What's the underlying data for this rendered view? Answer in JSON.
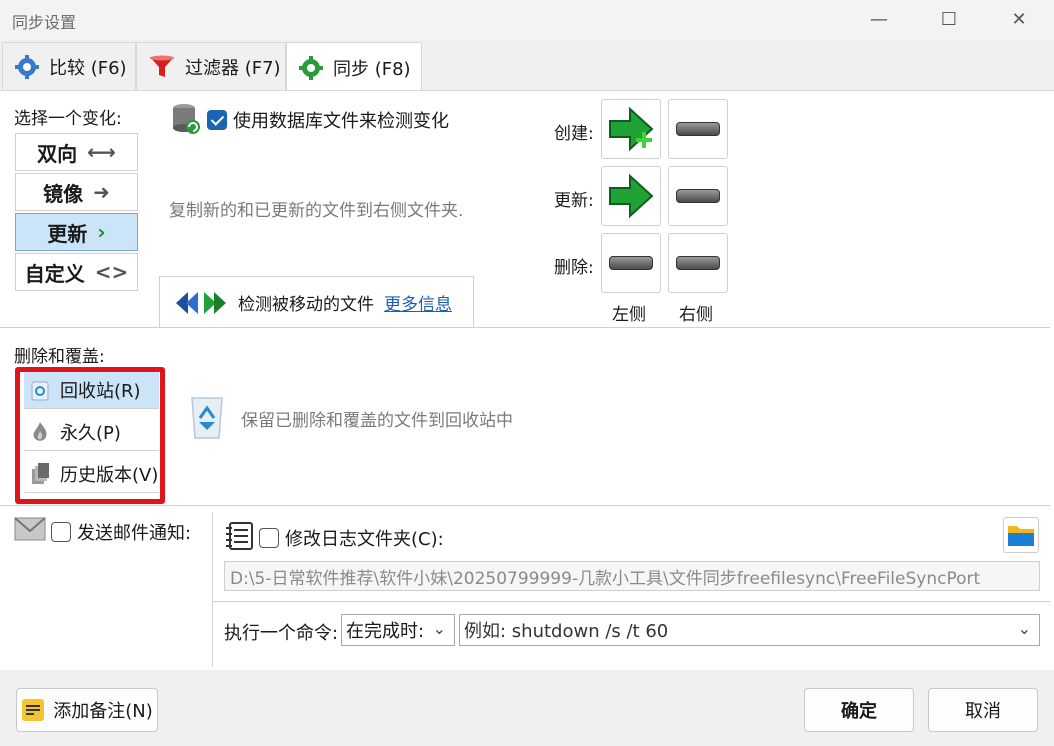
{
  "window": {
    "title": "同步设置",
    "minimize": "—",
    "maximize": "☐",
    "close": "✕"
  },
  "tabs": [
    {
      "label": "比较 (F6)",
      "icon": "gear-blue-icon"
    },
    {
      "label": "过滤器 (F7)",
      "icon": "funnel-red-icon"
    },
    {
      "label": "同步 (F8)",
      "icon": "gear-green-icon"
    }
  ],
  "variant": {
    "label": "选择一个变化:",
    "options": [
      {
        "label": "双向",
        "symbol": "⟷"
      },
      {
        "label": "镜像",
        "symbol": "➜"
      },
      {
        "label": "更新",
        "symbol": "›"
      },
      {
        "label": "自定义",
        "symbol": "<>"
      }
    ],
    "selected": "更新"
  },
  "database": {
    "label": "使用数据库文件来检测变化",
    "checked": true
  },
  "description": "复制新的和已更新的文件到右侧文件夹.",
  "detect": {
    "label": "检测被移动的文件",
    "more_info": "更多信息"
  },
  "actions": {
    "create_label": "创建:",
    "update_label": "更新:",
    "delete_label": "删除:",
    "left_label": "左侧",
    "right_label": "右侧"
  },
  "deletion": {
    "label": "删除和覆盖:",
    "options": [
      {
        "label": "回收站(R)"
      },
      {
        "label": "永久(P)"
      },
      {
        "label": "历史版本(V)"
      }
    ],
    "selected": "回收站(R)",
    "description": "保留已删除和覆盖的文件到回收站中"
  },
  "email": {
    "label": "发送邮件通知:",
    "checked": false
  },
  "log": {
    "label": "修改日志文件夹(C):",
    "checked": false,
    "path": "D:\\5-日常软件推荐\\软件小妹\\20250799999-几款小工具\\文件同步freefilesync\\FreeFileSyncPort"
  },
  "command": {
    "label": "执行一个命令:",
    "when": "在完成时:",
    "placeholder": "例如: shutdown /s /t 60"
  },
  "footer": {
    "add_note": "添加备注(N)",
    "ok": "确定",
    "cancel": "取消"
  },
  "colors": {
    "accent": "#1b66b3",
    "selected_bg": "#cce4f7",
    "highlight_red": "#e0151b",
    "green_arrow": "#1fa336"
  }
}
